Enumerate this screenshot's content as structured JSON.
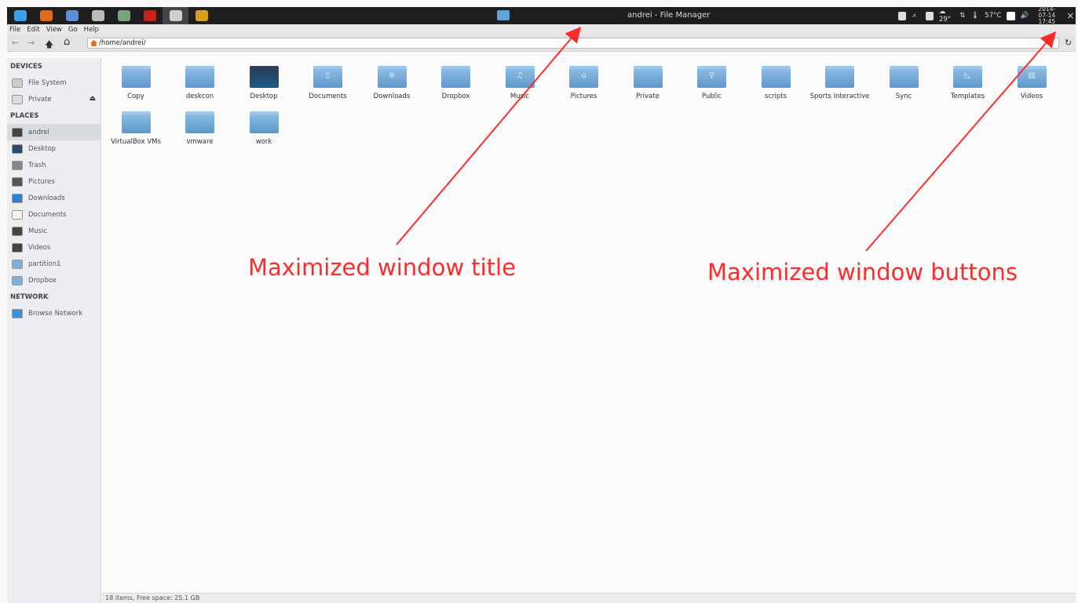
{
  "panel": {
    "launchers": [
      {
        "icon": "distro-menu-icon",
        "color": "#3aa0e8"
      },
      {
        "icon": "firefox-icon",
        "color": "#e06a1a"
      },
      {
        "icon": "yakyak-icon",
        "color": "#5b8dd6"
      },
      {
        "icon": "file-manager-icon",
        "color": "#bbbbbb"
      },
      {
        "icon": "system-monitor-icon",
        "color": "#7aa37a"
      },
      {
        "icon": "filezilla-icon",
        "color": "#c8201c"
      },
      {
        "icon": "file-manager-icon",
        "color": "#cfcfcf",
        "active": true
      },
      {
        "icon": "xbmc-icon",
        "color": "#d8a020"
      }
    ],
    "window_title": "andrei - File Manager",
    "tray": {
      "weather": "29°",
      "temperature": "57°C",
      "date": "2014-07-14",
      "time": "17:45",
      "window_buttons": [
        "×",
        "+",
        "−"
      ]
    }
  },
  "menubar": [
    "File",
    "Edit",
    "View",
    "Go",
    "Help"
  ],
  "toolbar": {
    "back": "←",
    "forward": "→",
    "up": "🡅",
    "home": "⌂",
    "location": "/home/andrei/",
    "reload": "↻"
  },
  "sidebar": {
    "devices_label": "DEVICES",
    "devices": [
      {
        "label": "File System",
        "icon": "drive-icon",
        "color": "#cccccc"
      },
      {
        "label": "Private",
        "icon": "drive-icon",
        "color": "#dddddd",
        "eject": "⏏"
      }
    ],
    "places_label": "PLACES",
    "places": [
      {
        "label": "andrei",
        "icon": "home-icon",
        "color": "#444444",
        "selected": true
      },
      {
        "label": "Desktop",
        "icon": "desktop-icon",
        "color": "#2c4a6e"
      },
      {
        "label": "Trash",
        "icon": "trash-icon",
        "color": "#888888"
      },
      {
        "label": "Pictures",
        "icon": "pictures-icon",
        "color": "#555555"
      },
      {
        "label": "Downloads",
        "icon": "downloads-icon",
        "color": "#2f7fd2"
      },
      {
        "label": "Documents",
        "icon": "documents-icon",
        "color": "#f4f4f4"
      },
      {
        "label": "Music",
        "icon": "music-icon",
        "color": "#444444"
      },
      {
        "label": "Videos",
        "icon": "videos-icon",
        "color": "#444444"
      },
      {
        "label": "partition1",
        "icon": "folder-icon",
        "color": "#7fb0dc"
      },
      {
        "label": "Dropbox",
        "icon": "folder-icon",
        "color": "#7fb0dc"
      }
    ],
    "network_label": "NETWORK",
    "network": [
      {
        "label": "Browse Network",
        "icon": "wifi-icon",
        "color": "#3d8fd6"
      }
    ]
  },
  "files": [
    {
      "name": "Copy",
      "glyph": ""
    },
    {
      "name": "deskcon",
      "glyph": ""
    },
    {
      "name": "Desktop",
      "glyph": "",
      "desktop": true
    },
    {
      "name": "Documents",
      "glyph": "▯"
    },
    {
      "name": "Downloads",
      "glyph": "⊕"
    },
    {
      "name": "Dropbox",
      "glyph": ""
    },
    {
      "name": "Music",
      "glyph": "♫"
    },
    {
      "name": "Pictures",
      "glyph": "⌂"
    },
    {
      "name": "Private",
      "glyph": ""
    },
    {
      "name": "Public",
      "glyph": "⚲"
    },
    {
      "name": "scripts",
      "glyph": ""
    },
    {
      "name": "Sports Interactive",
      "glyph": ""
    },
    {
      "name": "Sync",
      "glyph": ""
    },
    {
      "name": "Templates",
      "glyph": "◺"
    },
    {
      "name": "Videos",
      "glyph": "▤"
    },
    {
      "name": "VirtualBox VMs",
      "glyph": ""
    },
    {
      "name": "vmware",
      "glyph": ""
    },
    {
      "name": "work",
      "glyph": ""
    }
  ],
  "status": "18 items, Free space: 25.1 GB",
  "annotations": {
    "title_label": "Maximized window title",
    "buttons_label": "Maximized window buttons",
    "color": "#ff2b2b"
  }
}
